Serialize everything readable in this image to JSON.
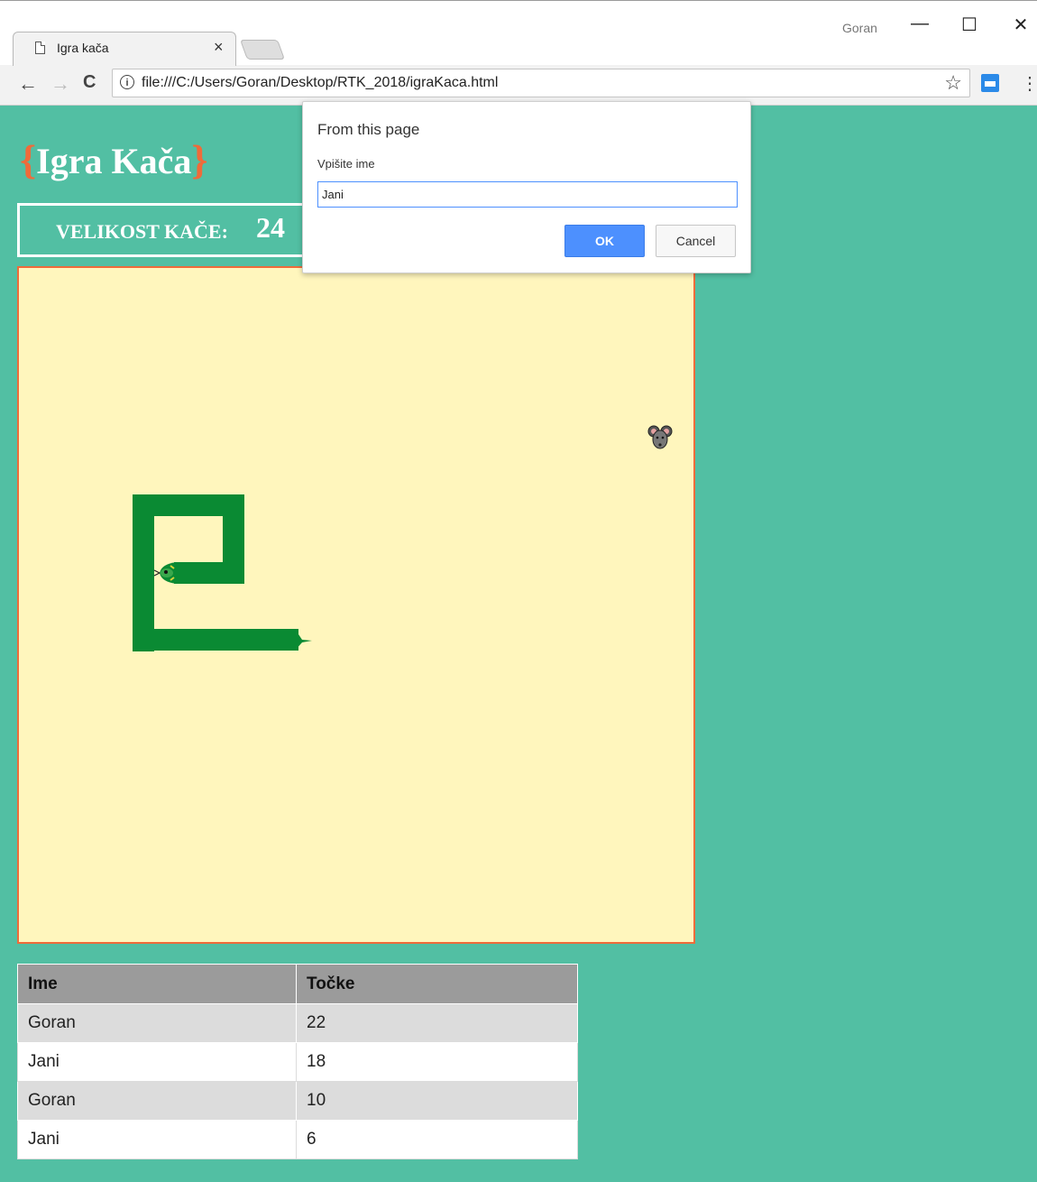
{
  "browser": {
    "tab_title": "Igra kača",
    "tab_close": "×",
    "profile_name": "Goran",
    "url": "file:///C:/Users/Goran/Desktop/RTK_2018/igraKaca.html",
    "window_controls": {
      "minimize": "—",
      "maximize": "☐",
      "close": "✕"
    },
    "nav": {
      "back": "←",
      "forward": "→",
      "reload": "C",
      "star": "☆",
      "menu": "⋮"
    }
  },
  "page": {
    "title_open": "{",
    "title": "Igra Kača",
    "title_close": "}",
    "size_label": "VELIKOST KAČE:",
    "size_value": "24",
    "colors": {
      "background": "#52bfa3",
      "board": "#fff6bd",
      "board_border": "#ef6b3a",
      "snake": "#0a8a33",
      "accent": "#ef6b3a"
    }
  },
  "game": {
    "snake_color": "#0a8a33",
    "food_icon": "mouse-icon"
  },
  "scores": {
    "headers": [
      "Ime",
      "Točke"
    ],
    "rows": [
      {
        "name": "Goran",
        "points": "22"
      },
      {
        "name": "Jani",
        "points": "18"
      },
      {
        "name": "Goran",
        "points": "10"
      },
      {
        "name": "Jani",
        "points": "6"
      }
    ]
  },
  "dialog": {
    "title": "From this page",
    "message": "Vpišite ime",
    "input_value": "Jani",
    "ok_label": "OK",
    "cancel_label": "Cancel"
  }
}
